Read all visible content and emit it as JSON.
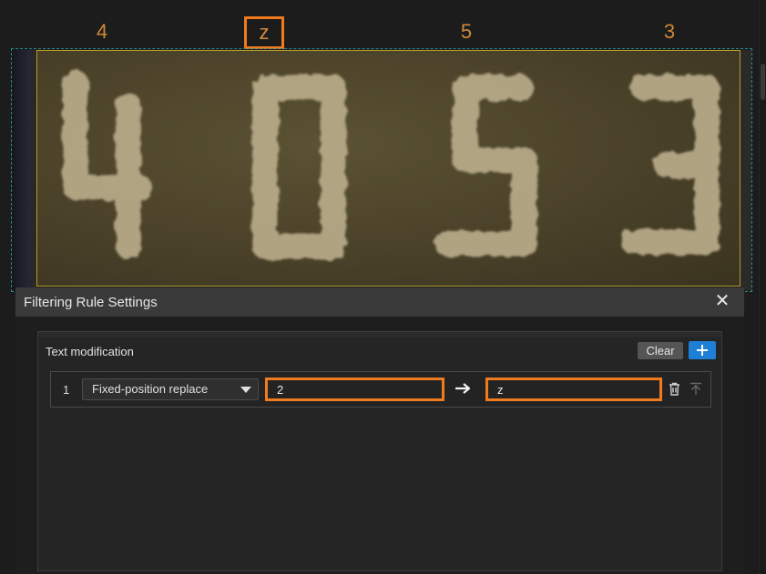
{
  "ocr_result": {
    "chars": [
      "4",
      "z",
      "5",
      "3"
    ],
    "selected_index": 1
  },
  "image_content": {
    "digits": [
      "4",
      "0",
      "5",
      "3"
    ]
  },
  "dialog": {
    "title": "Filtering Rule Settings",
    "close_icon": "close-icon"
  },
  "section": {
    "label": "Text modification",
    "clear_label": "Clear",
    "add_icon": "plus-icon"
  },
  "rules": [
    {
      "index": "1",
      "type": "Fixed-position replace",
      "from_value": "2",
      "to_value": "z",
      "arrow_icon": "right-arrow-icon",
      "delete_icon": "trash-icon",
      "move_icon": "move-to-top-icon"
    }
  ],
  "colors": {
    "highlight": "#f07b1e",
    "ocr_text": "#d0893a",
    "primary_button": "#1e7fd6",
    "roi_border": "#2b8a8a"
  }
}
